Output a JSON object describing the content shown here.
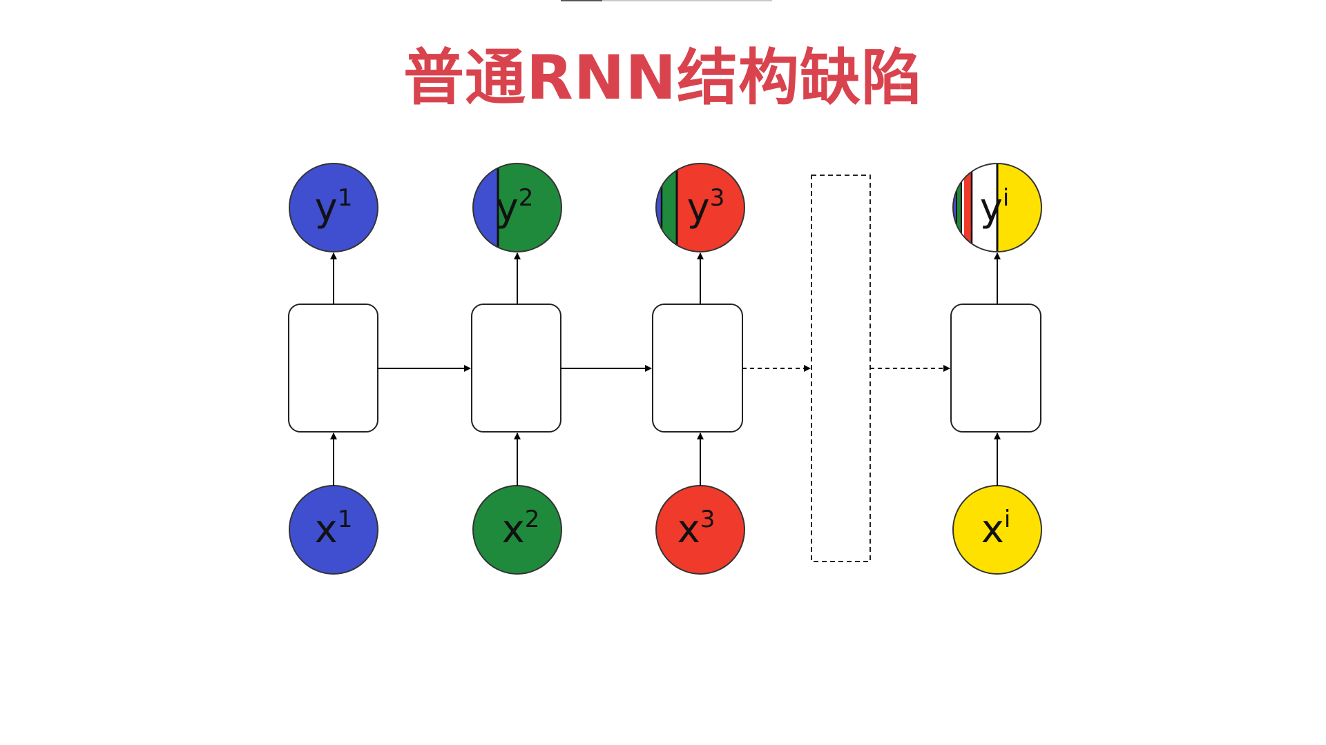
{
  "title": "普通RNN结构缺陷",
  "colors": {
    "title": "#d9434e",
    "blue": "#3f4fcf",
    "green": "#1f8a3c",
    "red": "#ef3a2c",
    "yellow": "#ffe100",
    "white": "#ffffff"
  },
  "steps": [
    {
      "input": {
        "base": "x",
        "sup": "1"
      },
      "output": {
        "base": "y",
        "sup": "1"
      }
    },
    {
      "input": {
        "base": "x",
        "sup": "2"
      },
      "output": {
        "base": "y",
        "sup": "2"
      }
    },
    {
      "input": {
        "base": "x",
        "sup": "3"
      },
      "output": {
        "base": "y",
        "sup": "3"
      }
    },
    {
      "input": {
        "base": "x",
        "sup": "i"
      },
      "output": {
        "base": "y",
        "sup": "i"
      }
    }
  ]
}
